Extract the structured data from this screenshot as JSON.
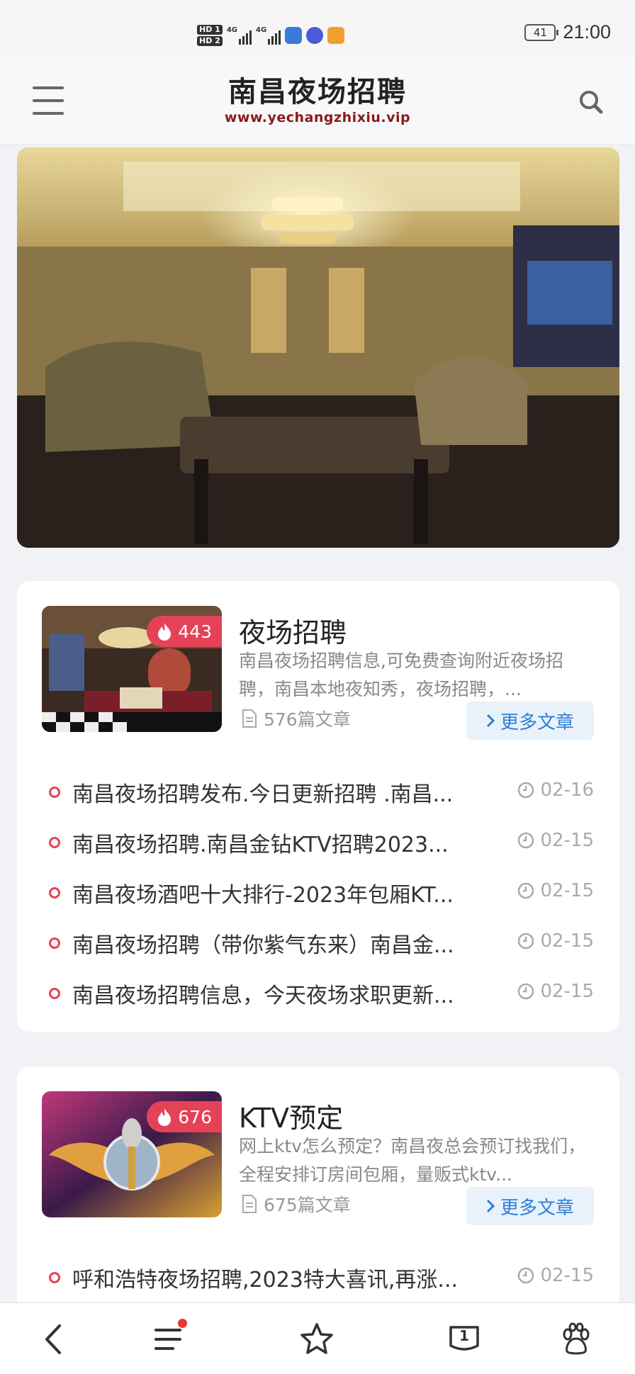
{
  "status_bar": {
    "hd1": "HD 1",
    "hd2": "HD 2",
    "signal1": "4G",
    "signal2": "4G",
    "battery": "41",
    "time": "21:00"
  },
  "header": {
    "title": "南昌夜场招聘",
    "url": "www.yechangzhixiu.vip"
  },
  "categories": [
    {
      "title": "夜场招聘",
      "heat": "443",
      "description": "南昌夜场招聘信息,可免费查询附近夜场招聘，南昌本地夜知秀，夜场招聘，...",
      "count": "576篇文章",
      "more_label": "更多文章",
      "articles": [
        {
          "title": "南昌夜场招聘发布.今日更新招聘 .南昌...",
          "date": "02-16"
        },
        {
          "title": "南昌夜场招聘.南昌金钻KTV招聘2023...",
          "date": "02-15"
        },
        {
          "title": "南昌夜场酒吧十大排行-2023年包厢KT...",
          "date": "02-15"
        },
        {
          "title": "南昌夜场招聘（带你紫气东来）南昌金...",
          "date": "02-15"
        },
        {
          "title": "南昌夜场招聘信息，今天夜场求职更新...",
          "date": "02-15"
        }
      ]
    },
    {
      "title": "KTV预定",
      "heat": "676",
      "description": "网上ktv怎么预定？南昌夜总会预订找我们，全程安排订房间包厢，量贩式ktv...",
      "count": "675篇文章",
      "more_label": "更多文章",
      "articles": [
        {
          "title": "呼和浩特夜场招聘,2023特大喜讯,再涨...",
          "date": "02-15"
        }
      ]
    }
  ],
  "bottom_nav": {
    "tabs_count": "1"
  },
  "colors": {
    "accent_red": "#e64257",
    "link_blue": "#2f80d6",
    "logo_url_red": "#8b1a1a"
  }
}
